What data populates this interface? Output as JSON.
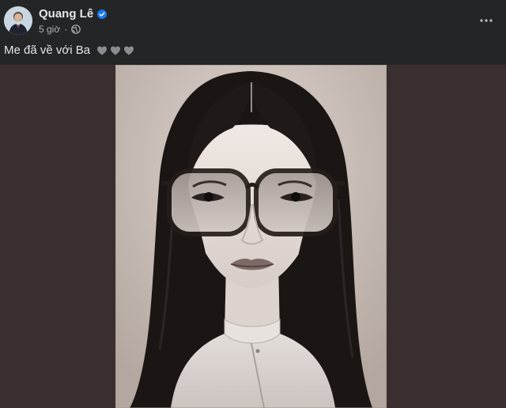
{
  "post": {
    "author": {
      "name": "Quang Lê",
      "verified": true,
      "avatar_icon": "profile-photo"
    },
    "meta": {
      "time": "5 giờ",
      "audience_icon": "globe-icon"
    },
    "menu_icon": "more-options-icon",
    "caption": {
      "text": "Me đã về với Ba",
      "emoji": [
        "grey-heart",
        "grey-heart",
        "grey-heart"
      ]
    },
    "media": {
      "type": "photo",
      "subject": "black-and-white portrait"
    }
  },
  "colors": {
    "background": "#242526",
    "media_backdrop": "#3a2f2f",
    "text_primary": "#e4e6eb",
    "text_secondary": "#b0b3b8",
    "verified_badge": "#1877f2"
  }
}
